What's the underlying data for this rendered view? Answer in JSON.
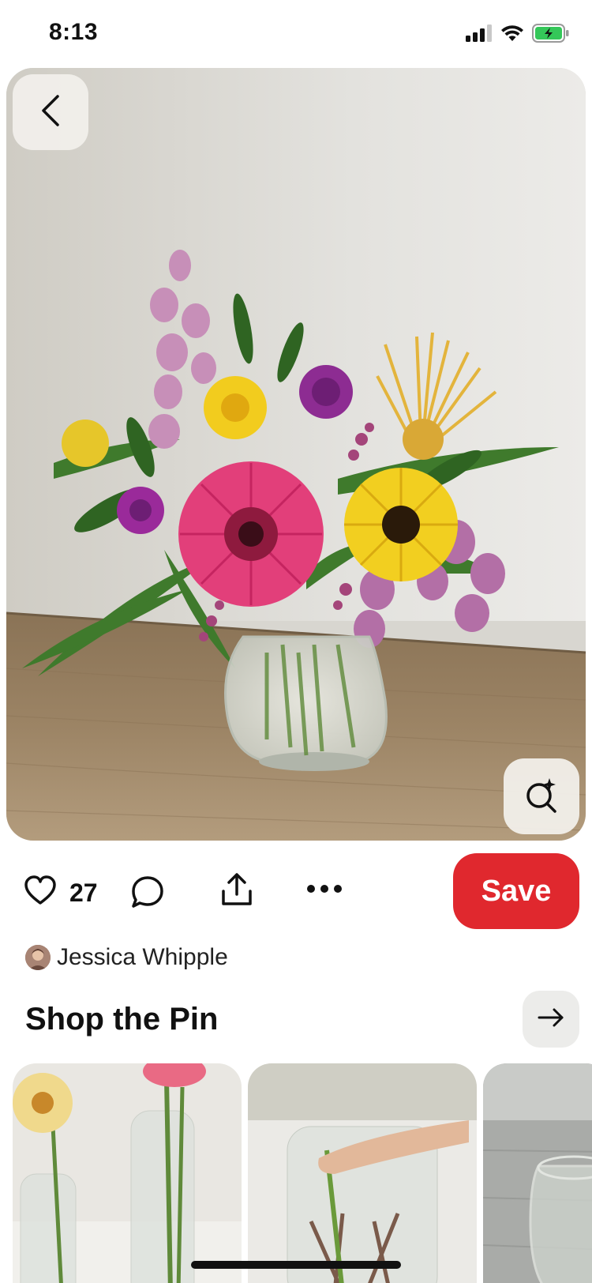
{
  "status_bar": {
    "time": "8:13",
    "signal_icon": "cellular-signal-icon",
    "wifi_icon": "wifi-icon",
    "battery_icon": "battery-charging-icon",
    "battery_color": "#34c759"
  },
  "pin": {
    "image_icon": "flower-arrangement-photo",
    "back_icon": "chevron-left-icon",
    "visual_search_icon": "visual-search-sparkle-icon"
  },
  "actions": {
    "like_icon": "heart-icon",
    "like_count": "27",
    "comment_icon": "speech-bubble-icon",
    "share_icon": "share-upload-icon",
    "more_icon": "ellipsis-icon",
    "save_label": "Save",
    "save_color": "#e0282e"
  },
  "creator": {
    "name": "Jessica Whipple"
  },
  "shop": {
    "title": "Shop the Pin",
    "arrow_icon": "arrow-right-icon",
    "products": [
      {
        "image": "bud-vases-with-dahlia-and-ranunculus"
      },
      {
        "image": "hand-arranging-stems-in-glass-vase"
      },
      {
        "image": "glass-vase-on-wood"
      }
    ]
  }
}
